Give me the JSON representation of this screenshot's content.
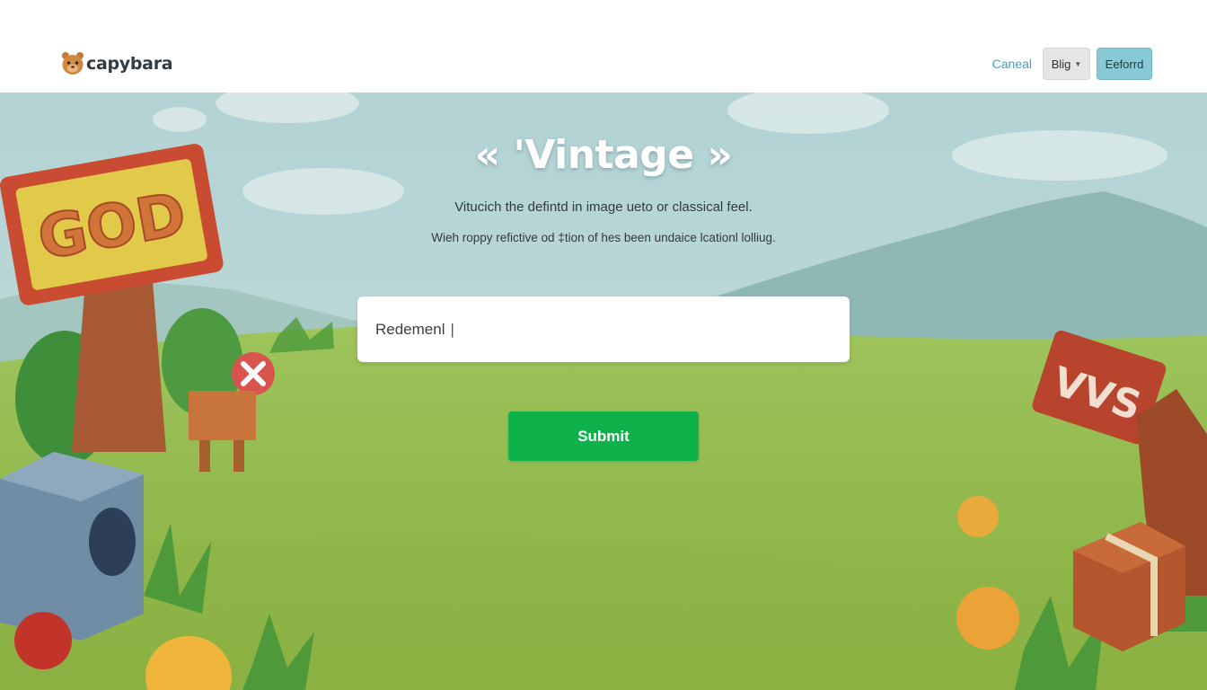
{
  "header": {
    "brand": "capybara",
    "cancel_label": "Caneal",
    "dropdown_label": "Blig",
    "primary_label": "Eeforrd"
  },
  "hero": {
    "title": "« 'Vintage »",
    "subtitle_line1": "Vitucich the defintd in image ueto or classical feel.",
    "subtitle_line2": "Wieh roppy refictive od ‡tion of hes been undaice lcationl lolliug.",
    "sign_left": "GOD",
    "sign_right": "VVS"
  },
  "form": {
    "input_value": "Redemenl",
    "submit_label": "Submit"
  },
  "colors": {
    "accent_teal": "#89c9d6",
    "submit_green": "#0fb14b",
    "link_blue": "#4a9ec4"
  }
}
